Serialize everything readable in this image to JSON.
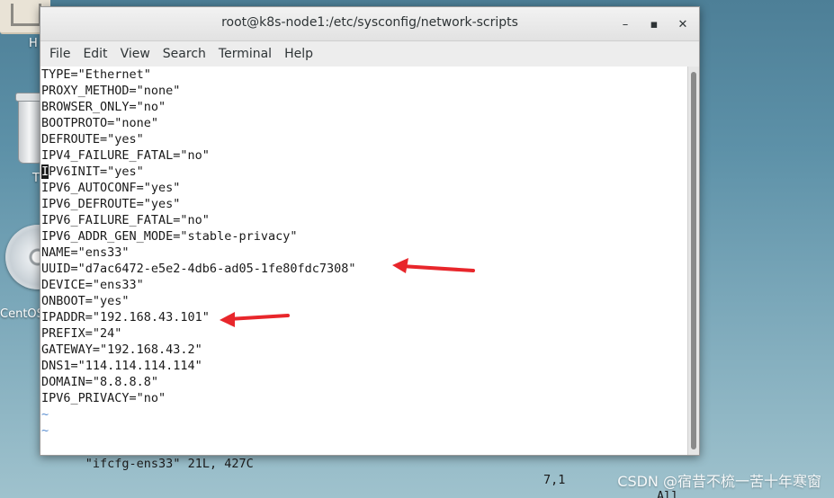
{
  "desktop": {
    "home_label": "H",
    "trash_label": "T",
    "cd_label": "CentOS"
  },
  "window": {
    "title": "root@k8s-node1:/etc/sysconfig/network-scripts",
    "minimize_glyph": "–",
    "maximize_glyph": "▪",
    "close_glyph": "✕"
  },
  "menu": {
    "file": "File",
    "edit": "Edit",
    "view": "View",
    "search": "Search",
    "terminal": "Terminal",
    "help": "Help"
  },
  "file_lines": [
    "TYPE=\"Ethernet\"",
    "PROXY_METHOD=\"none\"",
    "BROWSER_ONLY=\"no\"",
    "BOOTPROTO=\"none\"",
    "DEFROUTE=\"yes\"",
    "IPV4_FAILURE_FATAL=\"no\"",
    "PV6INIT=\"yes\"",
    "IPV6_AUTOCONF=\"yes\"",
    "IPV6_DEFROUTE=\"yes\"",
    "IPV6_FAILURE_FATAL=\"no\"",
    "IPV6_ADDR_GEN_MODE=\"stable-privacy\"",
    "NAME=\"ens33\"",
    "UUID=\"d7ac6472-e5e2-4db6-ad05-1fe80fdc7308\"",
    "DEVICE=\"ens33\"",
    "ONBOOT=\"yes\"",
    "IPADDR=\"192.168.43.101\"",
    "PREFIX=\"24\"",
    "GATEWAY=\"192.168.43.2\"",
    "DNS1=\"114.114.114.114\"",
    "DOMAIN=\"8.8.8.8\"",
    "IPV6_PRIVACY=\"no\""
  ],
  "cursor_char": "I",
  "tilde_lines": [
    "~",
    "~"
  ],
  "status": {
    "file_info": "\"ifcfg-ens33\" 21L, 427C",
    "position": "7,1",
    "scroll": "All"
  },
  "colors": {
    "annotation_arrow": "#e8262b",
    "tilde": "#5b8fd1"
  },
  "watermark": "CSDN @宿昔不梳一苦十年寒窗"
}
